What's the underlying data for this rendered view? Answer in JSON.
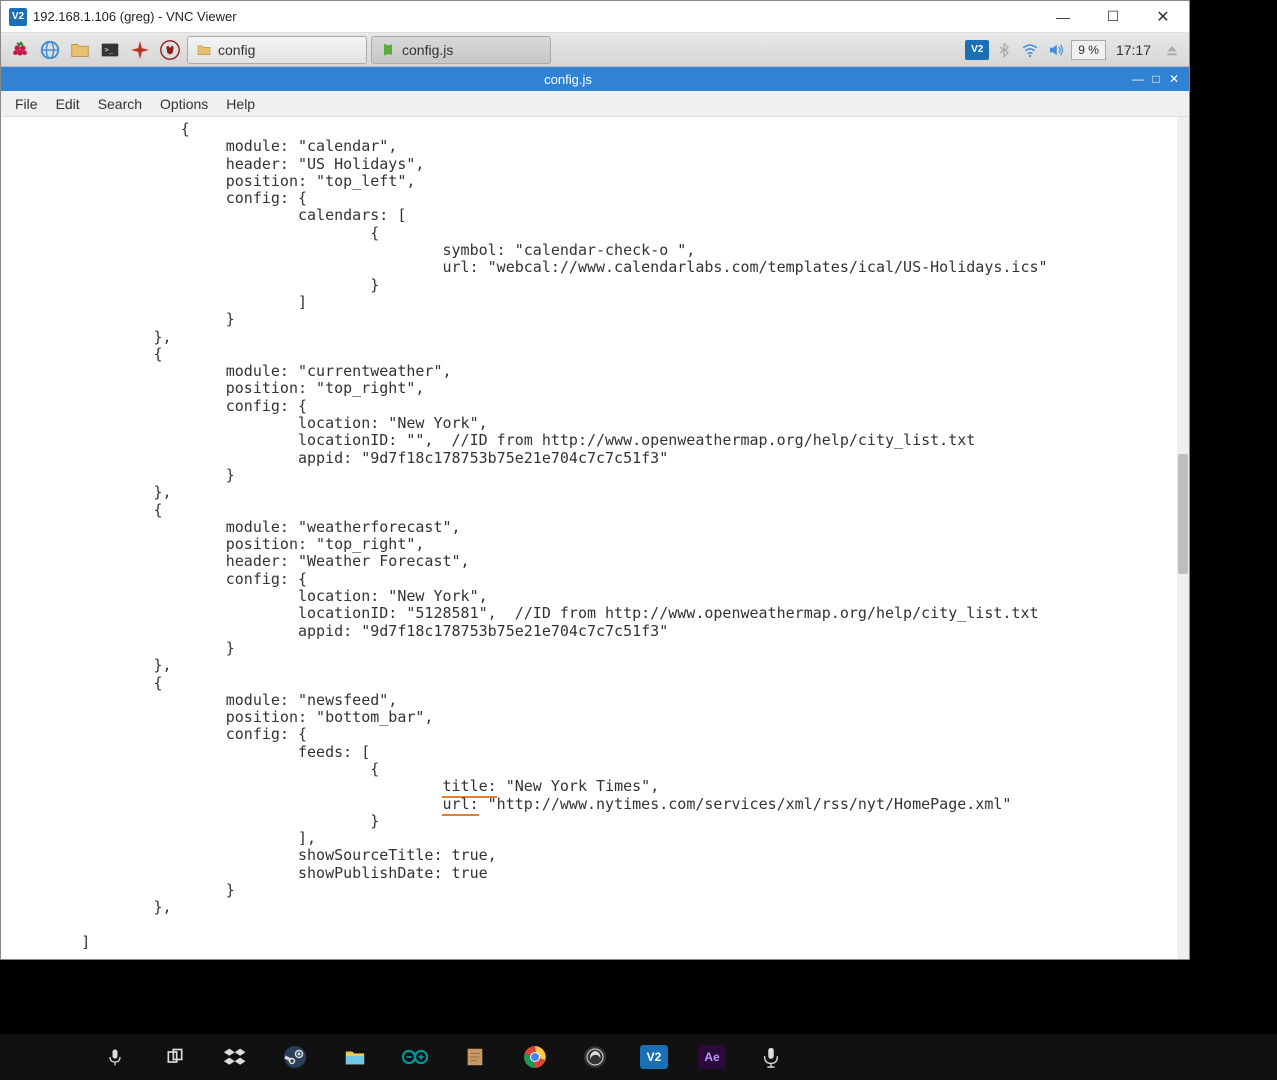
{
  "vnc": {
    "title": "192.168.1.106 (greg) - VNC Viewer",
    "minimize": "—",
    "maximize": "☐",
    "close": "✕"
  },
  "panel": {
    "task1": "config",
    "task2": "config.js",
    "battery": "9 %",
    "clock": "17:17",
    "tray_vnc": "V2"
  },
  "editor": {
    "title": "config.js",
    "menu": {
      "file": "File",
      "edit": "Edit",
      "search": "Search",
      "options": "Options",
      "help": "Help"
    },
    "code_pre": "                   {\n                        module: \"calendar\",\n                        header: \"US Holidays\",\n                        position: \"top_left\",\n                        config: {\n                                calendars: [\n                                        {\n                                                symbol: \"calendar-check-o \",\n                                                url: \"webcal://www.calendarlabs.com/templates/ical/US-Holidays.ics\"\n                                        }\n                                ]\n                        }\n                },\n                {\n                        module: \"currentweather\",\n                        position: \"top_right\",\n                        config: {\n                                location: \"New York\",\n                                locationID: \"\",  //ID from http://www.openweathermap.org/help/city_list.txt\n                                appid: \"9d7f18c178753b75e21e704c7c7c51f3\"\n                        }\n                },\n                {\n                        module: \"weatherforecast\",\n                        position: \"top_right\",\n                        header: \"Weather Forecast\",\n                        config: {\n                                location: \"New York\",\n                                locationID: \"5128581\",  //ID from http://www.openweathermap.org/help/city_list.txt\n                                appid: \"9d7f18c178753b75e21e704c7c7c51f3\"\n                        }\n                },\n                {\n                        module: \"newsfeed\",\n                        position: \"bottom_bar\",\n                        config: {\n                                feeds: [\n                                        {\n",
    "feed_title_key": "                                                title:",
    "feed_title_val": " \"New York Times\",\n",
    "feed_url_key": "                                                url:",
    "feed_url_val": " \"http://www.nytimes.com/services/xml/rss/nyt/HomePage.xml\"\n",
    "code_post": "                                        }\n                                ],\n                                showSourceTitle: true,\n                                showPublishDate: true\n                        }\n                },\n\n        ]\n\n};",
    "underline_title": "title:",
    "underline_url": "url:"
  },
  "win_controls": {
    "min": "—",
    "max": "□",
    "close": "✕"
  }
}
